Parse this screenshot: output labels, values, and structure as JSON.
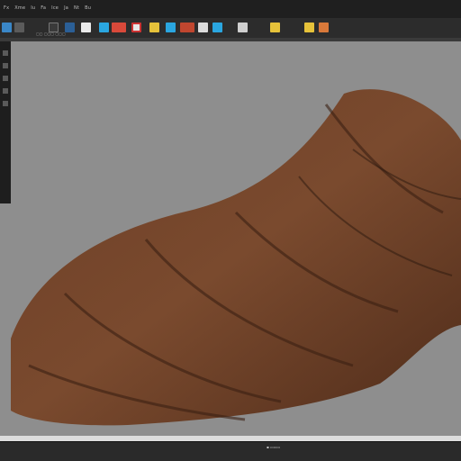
{
  "menubar": {
    "items": [
      "Fx",
      "Xme",
      "Iu",
      "Fa",
      "Ice",
      "Ja",
      "Nt",
      "Bu"
    ]
  },
  "toolbar": {
    "caption": "▢▢  ▢▢▢  ▢▢▢"
  },
  "icons": [
    "move-icon",
    "rotate-icon",
    "scale-icon",
    "select-icon",
    "bucket-icon",
    "brush-icon",
    "red-icon",
    "sculpt-icon",
    "layers-icon",
    "light-icon",
    "camera-icon",
    "render-icon",
    "material-icon",
    "grid-icon",
    "snap-icon",
    "settings-icon"
  ],
  "colors": {
    "accent_red": "#d9493a",
    "accent_blue": "#2aa6e0",
    "accent_yellow": "#e6c23a",
    "wood": "#7a4a2e"
  },
  "status": {
    "text": "▪ ▭▭▭"
  }
}
